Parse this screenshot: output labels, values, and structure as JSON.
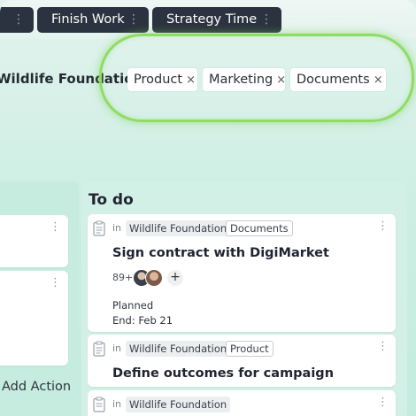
{
  "tabs": [
    {
      "label": "g"
    },
    {
      "label": "Finish Work"
    },
    {
      "label": "Strategy Time"
    }
  ],
  "filter": {
    "organization": "Wildlife Foundation",
    "tags": [
      "Product",
      "Marketing",
      "Documents"
    ],
    "remove_glyph": "×"
  },
  "left_column": {
    "add_action_label": "Add Action"
  },
  "todo": {
    "title": "To do",
    "in_label": "in",
    "cards": [
      {
        "organization": "Wildlife Foundation",
        "tag": "Documents",
        "title": "Sign contract with DigiMarket",
        "member_count": "89+",
        "status": "Planned",
        "end": "End: Feb 21"
      },
      {
        "organization": "Wildlife Foundation",
        "tag": "Product",
        "title": "Define outcomes for campaign"
      },
      {
        "organization": "Wildlife Foundation"
      }
    ]
  },
  "colors": {
    "tab_bg": "#2b3340",
    "highlight_ring": "#8fdc64",
    "column_bg": "#d3f0e7"
  },
  "icons": [
    "kebab-menu-icon",
    "clipboard-icon",
    "remove-tag-icon",
    "add-member-icon"
  ]
}
